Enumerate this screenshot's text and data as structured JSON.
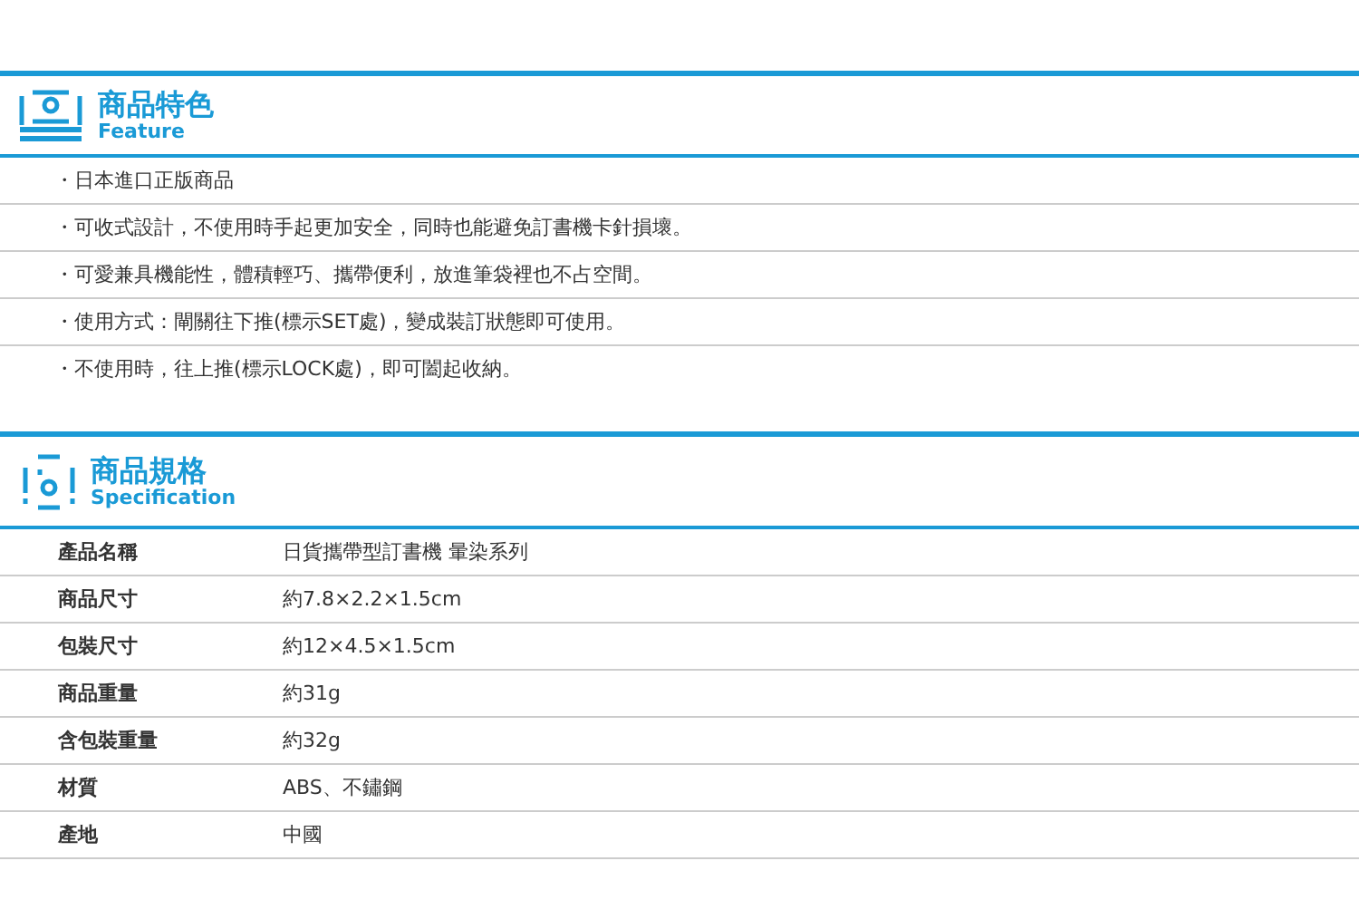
{
  "feature": {
    "title": "商品特色",
    "subtitle": "Feature",
    "items": [
      "・日本進口正版商品",
      "・可收式設計，不使用時手起更加安全，同時也能避免訂書機卡針損壞。",
      "・可愛兼具機能性，體積輕巧、攜帶便利，放進筆袋裡也不占空間。",
      "・使用方式：閘關往下推(標示SET處)，變成裝訂狀態即可使用。",
      "・不使用時，往上推(標示LOCK處)，即可闔起收納。"
    ]
  },
  "specification": {
    "title": "商品規格",
    "subtitle": "Specification",
    "rows": [
      {
        "label": "產品名稱",
        "value": "日貨攜帶型訂書機 暈染系列"
      },
      {
        "label": "商品尺寸",
        "value": "約7.8×2.2×1.5cm"
      },
      {
        "label": "包裝尺寸",
        "value": "約12×4.5×1.5cm"
      },
      {
        "label": "商品重量",
        "value": "約31g"
      },
      {
        "label": "含包裝重量",
        "value": "約32g"
      },
      {
        "label": "材質",
        "value": "ABS、不鏽鋼"
      },
      {
        "label": "產地",
        "value": "中國"
      }
    ]
  }
}
